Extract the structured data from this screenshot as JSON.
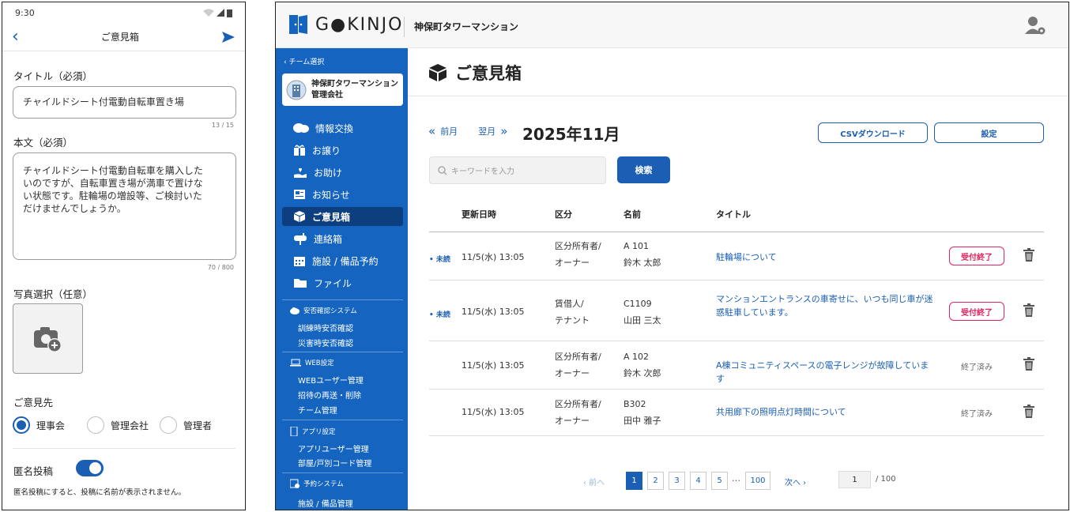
{
  "phone": {
    "time": "9:30",
    "title": "ご意見箱",
    "title_label": "タイトル（必須）",
    "title_value": "チャイルドシート付電動自転車置き場",
    "title_count": "13 / 15",
    "body_label": "本文（必須）",
    "body_lines": [
      "チャイルドシート付電動自転車を購入した",
      "いのですが、自転車置き場が満車で置けな",
      "い状態です。駐輪場の増設等、ご検討いた",
      "だけませんでしょうか。"
    ],
    "body_count": "70 / 800",
    "photo_label": "写真選択（任意）",
    "dest_label": "ご意見先",
    "options": [
      "理事会",
      "管理会社",
      "管理者"
    ],
    "selected_option": "理事会",
    "anon_label": "匿名投稿",
    "anon_on": true,
    "anon_note": "匿名投稿にすると、投稿に名前が表示されません。"
  },
  "admin": {
    "logo": "G●KINJO",
    "building": "神保町タワーマンション",
    "sidebar": {
      "team_select": "‹ チーム選択",
      "team_name_1": "神保町タワーマンション",
      "team_name_2": "管理会社",
      "menu": [
        "情報交換",
        "お譲り",
        "お助け",
        "お知らせ",
        "ご意見箱",
        "連絡箱",
        "施設 / 備品予約",
        "ファイル"
      ],
      "active": "ご意見箱",
      "sections": [
        {
          "title": "安否確認システム",
          "items": [
            "訓練時安否確認",
            "災害時安否確認"
          ]
        },
        {
          "title": "WEB設定",
          "items": [
            "WEBユーザー管理",
            "招待の再送・削除",
            "チーム管理"
          ]
        },
        {
          "title": "アプリ設定",
          "items": [
            "アプリユーザー管理",
            "部屋/戸別コード管理"
          ]
        },
        {
          "title": "予約システム",
          "items": [
            "施設 / 備品管理"
          ]
        }
      ]
    },
    "page_title": "ご意見箱",
    "prev_month": "前月",
    "next_month": "翌月",
    "month": "2025年11月",
    "csv_button": "CSVダウンロード",
    "settings_button": "設定",
    "search_placeholder": "キーワードを入力",
    "search_button": "検索",
    "columns": [
      "更新日時",
      "区分",
      "名前",
      "タイトル"
    ],
    "rows": [
      {
        "unread": "未読",
        "date": "11/5(水) 13:05",
        "type1": "区分所有者/",
        "type2": "オーナー",
        "room": "A 101",
        "name": "鈴木 太郎",
        "title": "駐輪場について",
        "status": "受付終了",
        "status_kind": "badge"
      },
      {
        "unread": "未読",
        "date": "11/5(水) 13:05",
        "type1": "賃借人/",
        "type2": "テナント",
        "room": "C1109",
        "name": "山田 三太",
        "title": "マンションエントランスの車寄せに、いつも同じ車が迷惑駐車しています。",
        "status": "受付終了",
        "status_kind": "badge"
      },
      {
        "unread": "",
        "date": "11/5(水) 13:05",
        "type1": "区分所有者/",
        "type2": "オーナー",
        "room": "A 102",
        "name": "鈴木 次郎",
        "title": "A棟コミュニティスペースの電子レンジが故障しています",
        "status": "終了済み",
        "status_kind": "text"
      },
      {
        "unread": "",
        "date": "11/5(水) 13:05",
        "type1": "区分所有者/",
        "type2": "オーナー",
        "room": "B302",
        "name": "田中 雅子",
        "title": "共用廊下の照明点灯時間について",
        "status": "終了済み",
        "status_kind": "text"
      }
    ],
    "pager": {
      "prev": "‹ 前へ",
      "pages": [
        "1",
        "2",
        "3",
        "4",
        "5"
      ],
      "ellipsis": "…",
      "last": "100",
      "next": "次へ ›",
      "current": "1",
      "jump_value": "1",
      "total": "/ 100"
    }
  },
  "colors": {
    "primary": "#1565c0",
    "accent": "#1a5fb4",
    "alert": "#e0245e"
  }
}
